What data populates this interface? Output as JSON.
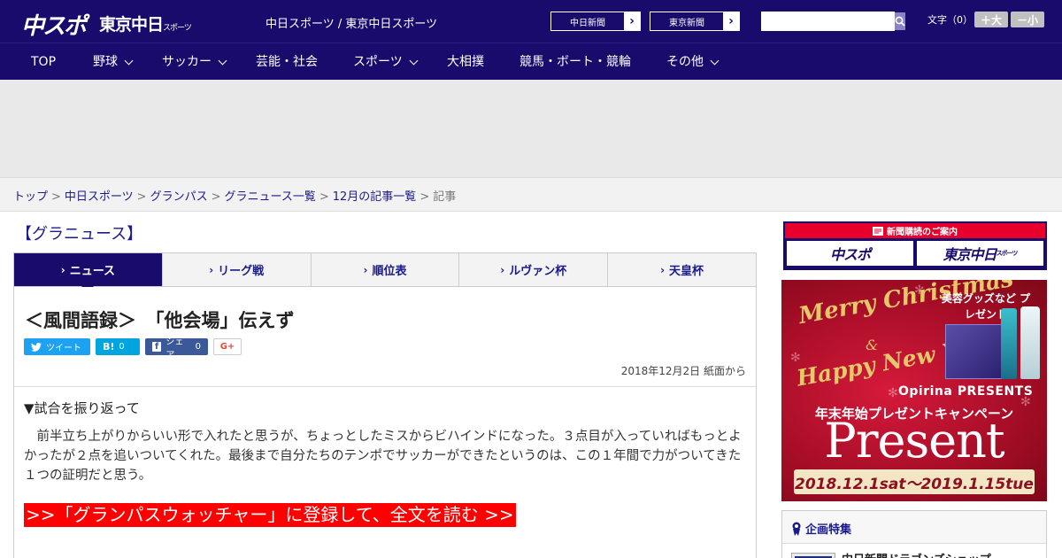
{
  "header": {
    "logo_chuspo": "中スポ",
    "logo_tokyo": "東京中日",
    "logo_tokyo_suffix": "スポーツ",
    "site_title": "中日スポーツ / 東京中日スポーツ",
    "paper_links": [
      "中日新聞",
      "東京新聞"
    ],
    "search_placeholder": "",
    "font_size_label": "文字（0）",
    "font_larger": "＋大",
    "font_smaller": "－小"
  },
  "nav": {
    "items": [
      {
        "label": "TOP",
        "dropdown": false
      },
      {
        "label": "野球",
        "dropdown": true
      },
      {
        "label": "サッカー",
        "dropdown": true
      },
      {
        "label": "芸能・社会",
        "dropdown": false
      },
      {
        "label": "スポーツ",
        "dropdown": true
      },
      {
        "label": "大相撲",
        "dropdown": false
      },
      {
        "label": "競馬・ボート・競輪",
        "dropdown": false
      },
      {
        "label": "その他",
        "dropdown": true
      }
    ]
  },
  "breadcrumb": {
    "items": [
      "トップ",
      "中日スポーツ",
      "グランパス",
      "グラニュース一覧",
      "12月の記事一覧"
    ],
    "current": "記事",
    "separator": ">"
  },
  "main": {
    "section_title": "【グラニュース】",
    "tabs": [
      {
        "label": "ニュース",
        "active": true
      },
      {
        "label": "リーグ戦",
        "active": false
      },
      {
        "label": "順位表",
        "active": false
      },
      {
        "label": "ルヴァン杯",
        "active": false
      },
      {
        "label": "天皇杯",
        "active": false
      }
    ],
    "tab_chevron": "›",
    "article": {
      "headline": "＜風間語録＞　「他会場」伝えず",
      "share": {
        "tweet_label": "ツイート",
        "hatena_label": "B!",
        "hatena_count": "0",
        "facebook_label": "シェア",
        "facebook_count": "0",
        "gplus_label": "G+"
      },
      "date": "2018年12月2日 紙面から",
      "subhead": "▼試合を振り返って",
      "body": "前半立ち上がりからいい形で入れたと思うが、ちょっとしたミスからビハインドになった。３点目が入っていればもっとよかったが２点を追いついてくれた。最後まで自分たちのテンポでサッカーができたというのは、この１年間で力がついてきた１つの証明だと思う。",
      "register_link": ">>「グランパスウォッチャー」に登録して、全文を読む >>"
    }
  },
  "sidebar": {
    "subscribe": {
      "heading": "新聞購読のご案内",
      "logos": [
        "中スポ",
        "東京中日"
      ],
      "logo_suffix": "スポーツ"
    },
    "banner": {
      "merry": "Merry Christmas",
      "amp": "&",
      "happy": "Happy New Year",
      "goods": "美容グッズなど プレゼント",
      "brand": "Opirina PRESENTS",
      "campaign": "年末年始プレゼントキャンペーン",
      "present": "Present",
      "dates": "2018.12.1sat～2019.1.15tue"
    },
    "special": {
      "heading": "企画特集",
      "item": "中日新聞ドラゴンズショップ"
    }
  },
  "colors": {
    "brand_navy": "#180b6c",
    "link_blue": "#1a1a8c",
    "register_red": "#ff0000",
    "subscribe_red": "#e8002d"
  }
}
